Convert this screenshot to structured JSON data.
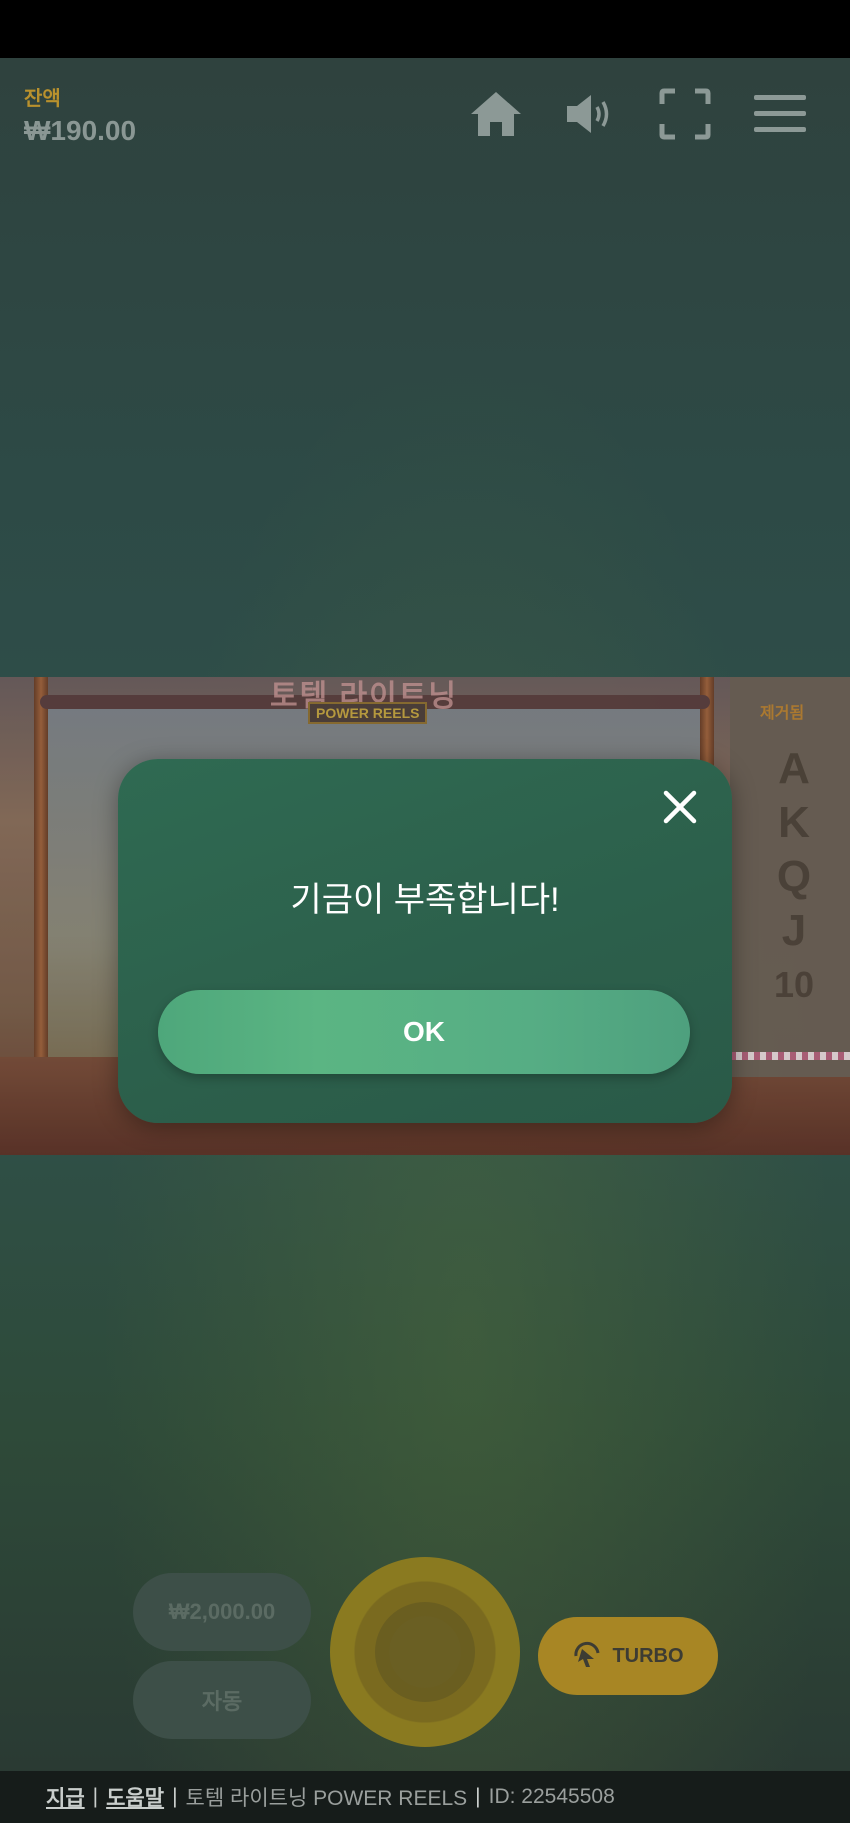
{
  "header": {
    "balance_label": "잔액",
    "balance_value": "₩190.00",
    "icons": [
      "home-icon",
      "speaker-icon",
      "fullscreen-icon",
      "menu-icon"
    ]
  },
  "game": {
    "title": "토템 라이트닝",
    "subtitle": "POWER REELS",
    "side_header": "제거됨",
    "removed_symbols": [
      "A",
      "K",
      "Q",
      "J",
      "10"
    ]
  },
  "controls": {
    "bet_value": "₩2,000.00",
    "auto_label": "자동",
    "turbo_label": "TURBO"
  },
  "modal": {
    "message": "기금이 부족합니다!",
    "ok_label": "OK"
  },
  "footer": {
    "payout_link": "지급",
    "help_link": "도움말",
    "separator": "|",
    "game_name": "토템 라이트닝 POWER REELS",
    "id_text": "ID: 22545508"
  },
  "colors": {
    "modal_bg": "#2c5f4b",
    "ok_button": "#56ad84",
    "balance_label": "#b9912d",
    "turbo": "#a88624"
  }
}
